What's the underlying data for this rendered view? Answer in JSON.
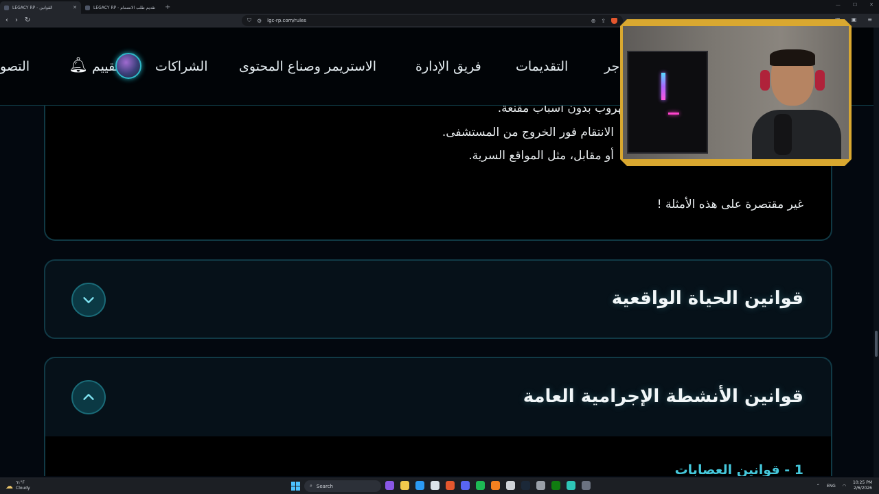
{
  "browser": {
    "tabs": [
      {
        "title": "LEGACY RP - القوانين",
        "active": true
      },
      {
        "title": "LEGACY RP - تقديم طلب الانضمام",
        "active": false
      }
    ],
    "new_tab": "+",
    "url": "lgc-rp.com/rules"
  },
  "nav": {
    "items": [
      "التصو",
      "الشراكات",
      "تقييم",
      "الاستريمر وصناع المحتوى",
      "فريق الإدارة",
      "التقديمات",
      "جر"
    ]
  },
  "rules_top": {
    "lines": [
      "في حادث ومحاكاة السيناريو وتقوم بالهروب بدون أسباب مقنعة.",
      "الانتقام فور الخروج من المستشفى.",
      "أو مقابل، مثل المواقع السرية.",
      "غير مقتصرة على هذه الأمثلة !"
    ]
  },
  "sections": [
    {
      "title": "قوانين الحياة الواقعية",
      "expanded": false
    },
    {
      "title": "قوانين الأنشطة الإجرامية العامة",
      "expanded": true,
      "first_item": "1 - قوانين العصابات"
    }
  ],
  "taskbar": {
    "weather_temp": "٦١°F",
    "weather_desc": "Cloudy",
    "search_label": "Search",
    "lang": "ENG",
    "time": "10:25 PM",
    "date": "2/6/2026"
  },
  "colors": {
    "accent": "#45c8dc",
    "border": "#113a46",
    "webcam_frame": "#d9a830"
  }
}
